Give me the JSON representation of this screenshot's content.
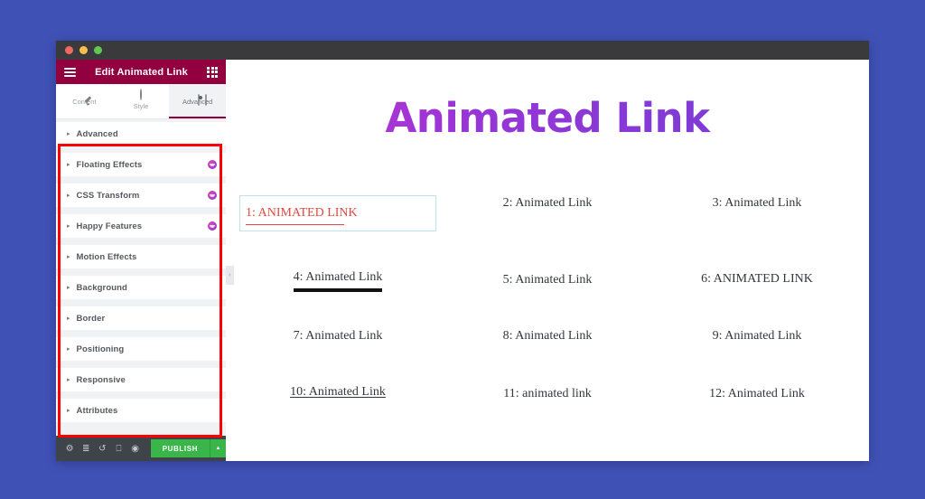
{
  "window": {
    "traffic_lights": [
      "close",
      "minimize",
      "maximize"
    ]
  },
  "panel": {
    "title": "Edit Animated Link",
    "menu_icon": "hamburger-icon",
    "apps_icon": "grid-icon",
    "tabs": [
      {
        "label": "Content",
        "icon": "pencil-icon",
        "active": false
      },
      {
        "label": "Style",
        "icon": "contrast-icon",
        "active": false
      },
      {
        "label": "Advanced",
        "icon": "gear-icon",
        "active": true
      }
    ],
    "sections": [
      {
        "label": "Advanced",
        "badge": false
      },
      {
        "label": "Floating Effects",
        "badge": true
      },
      {
        "label": "CSS Transform",
        "badge": true
      },
      {
        "label": "Happy Features",
        "badge": true
      },
      {
        "label": "Motion Effects",
        "badge": false
      },
      {
        "label": "Background",
        "badge": false
      },
      {
        "label": "Border",
        "badge": false
      },
      {
        "label": "Positioning",
        "badge": false
      },
      {
        "label": "Responsive",
        "badge": false
      },
      {
        "label": "Attributes",
        "badge": false
      }
    ],
    "caret": "▸",
    "footer": {
      "icons": [
        {
          "name": "settings-icon",
          "glyph": "⚙"
        },
        {
          "name": "navigator-icon",
          "glyph": "≣"
        },
        {
          "name": "history-icon",
          "glyph": "↺"
        },
        {
          "name": "responsive-mode-icon",
          "glyph": "⎕"
        },
        {
          "name": "preview-icon",
          "glyph": "◉"
        }
      ],
      "publish_label": "PUBLISH",
      "publish_dropdown_glyph": "▲"
    }
  },
  "preview": {
    "collapse_glyph": "‹",
    "heading": "Animated Link",
    "heading_gradient_from": "#c13bcd",
    "heading_gradient_to": "#6d3fd6",
    "selected_color": "#dd4b42",
    "selection_border_color": "#b9e4ee",
    "rows": [
      [
        {
          "text": "1: ANIMATED LINK",
          "selected": true,
          "underline": "selected"
        },
        {
          "text": "2: Animated Link",
          "selected": false,
          "underline": "none"
        },
        {
          "text": "3: Animated Link",
          "selected": false,
          "underline": "none"
        }
      ],
      [
        {
          "text": "4: Animated Link",
          "selected": false,
          "underline": "thick"
        },
        {
          "text": "5: Animated Link",
          "selected": false,
          "underline": "none"
        },
        {
          "text": "6: ANIMATED LINK",
          "selected": false,
          "underline": "none"
        }
      ],
      [
        {
          "text": "7: Animated Link",
          "selected": false,
          "underline": "none"
        },
        {
          "text": "8: Animated Link",
          "selected": false,
          "underline": "none"
        },
        {
          "text": "9: Animated Link",
          "selected": false,
          "underline": "none"
        }
      ],
      [
        {
          "text": "10: Animated Link",
          "selected": false,
          "underline": "inline"
        },
        {
          "text": "11: animated link",
          "selected": false,
          "underline": "none"
        },
        {
          "text": "12: Animated Link",
          "selected": false,
          "underline": "none"
        }
      ]
    ]
  },
  "annotation": {
    "color": "#ff0000",
    "target": "advanced-sections-list"
  },
  "colors": {
    "page_background": "#3f51b5",
    "panel_header": "#93003f",
    "titlebar": "#3a3a3c",
    "footer": "#3f444b",
    "publish": "#39b54a"
  }
}
